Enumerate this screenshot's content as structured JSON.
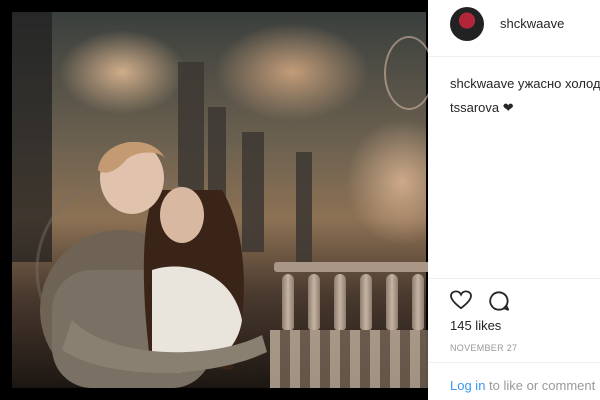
{
  "post": {
    "username": "shckwaave",
    "caption_user": "shckwaave",
    "caption_text": " ужасно холод",
    "caption_line2": "tssarova",
    "caption_heart": " ❤",
    "likes": "145 likes",
    "date": "NOVEMBER 27"
  },
  "actions": {
    "like_icon": "heart-outline-icon",
    "comment_icon": "comment-bubble-icon"
  },
  "footer": {
    "login_link": "Log in",
    "login_rest": " to like or comment"
  },
  "colors": {
    "link": "#3897f0",
    "text": "#262626",
    "muted": "#999999"
  }
}
